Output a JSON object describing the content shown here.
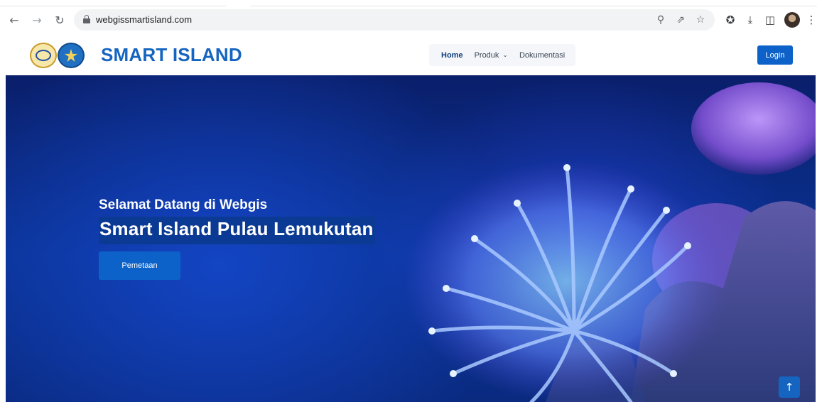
{
  "browser": {
    "url": "webgissmartisland.com",
    "icons": {
      "back": "arrow-left-icon",
      "forward": "arrow-right-icon",
      "reload": "reload-icon",
      "zoom": "zoom-icon",
      "share": "share-icon",
      "bookmark": "star-icon",
      "extensions": "puzzle-icon",
      "download": "download-icon",
      "sidepanel": "side-panel-icon",
      "menu": "kebab-menu-icon"
    }
  },
  "header": {
    "brand": "SMART ISLAND",
    "nav": [
      {
        "label": "Home",
        "active": true
      },
      {
        "label": "Produk",
        "dropdown": true
      },
      {
        "label": "Dokumentasi"
      }
    ],
    "login_label": "Login"
  },
  "hero": {
    "welcome": "Selamat Datang di Webgis",
    "headline": "Smart Island Pulau Lemukutan",
    "cta_label": "Pemetaan"
  },
  "colors": {
    "brand": "#1565c0",
    "button": "#0d62c9",
    "hero_dark": "#0a1f6b"
  }
}
